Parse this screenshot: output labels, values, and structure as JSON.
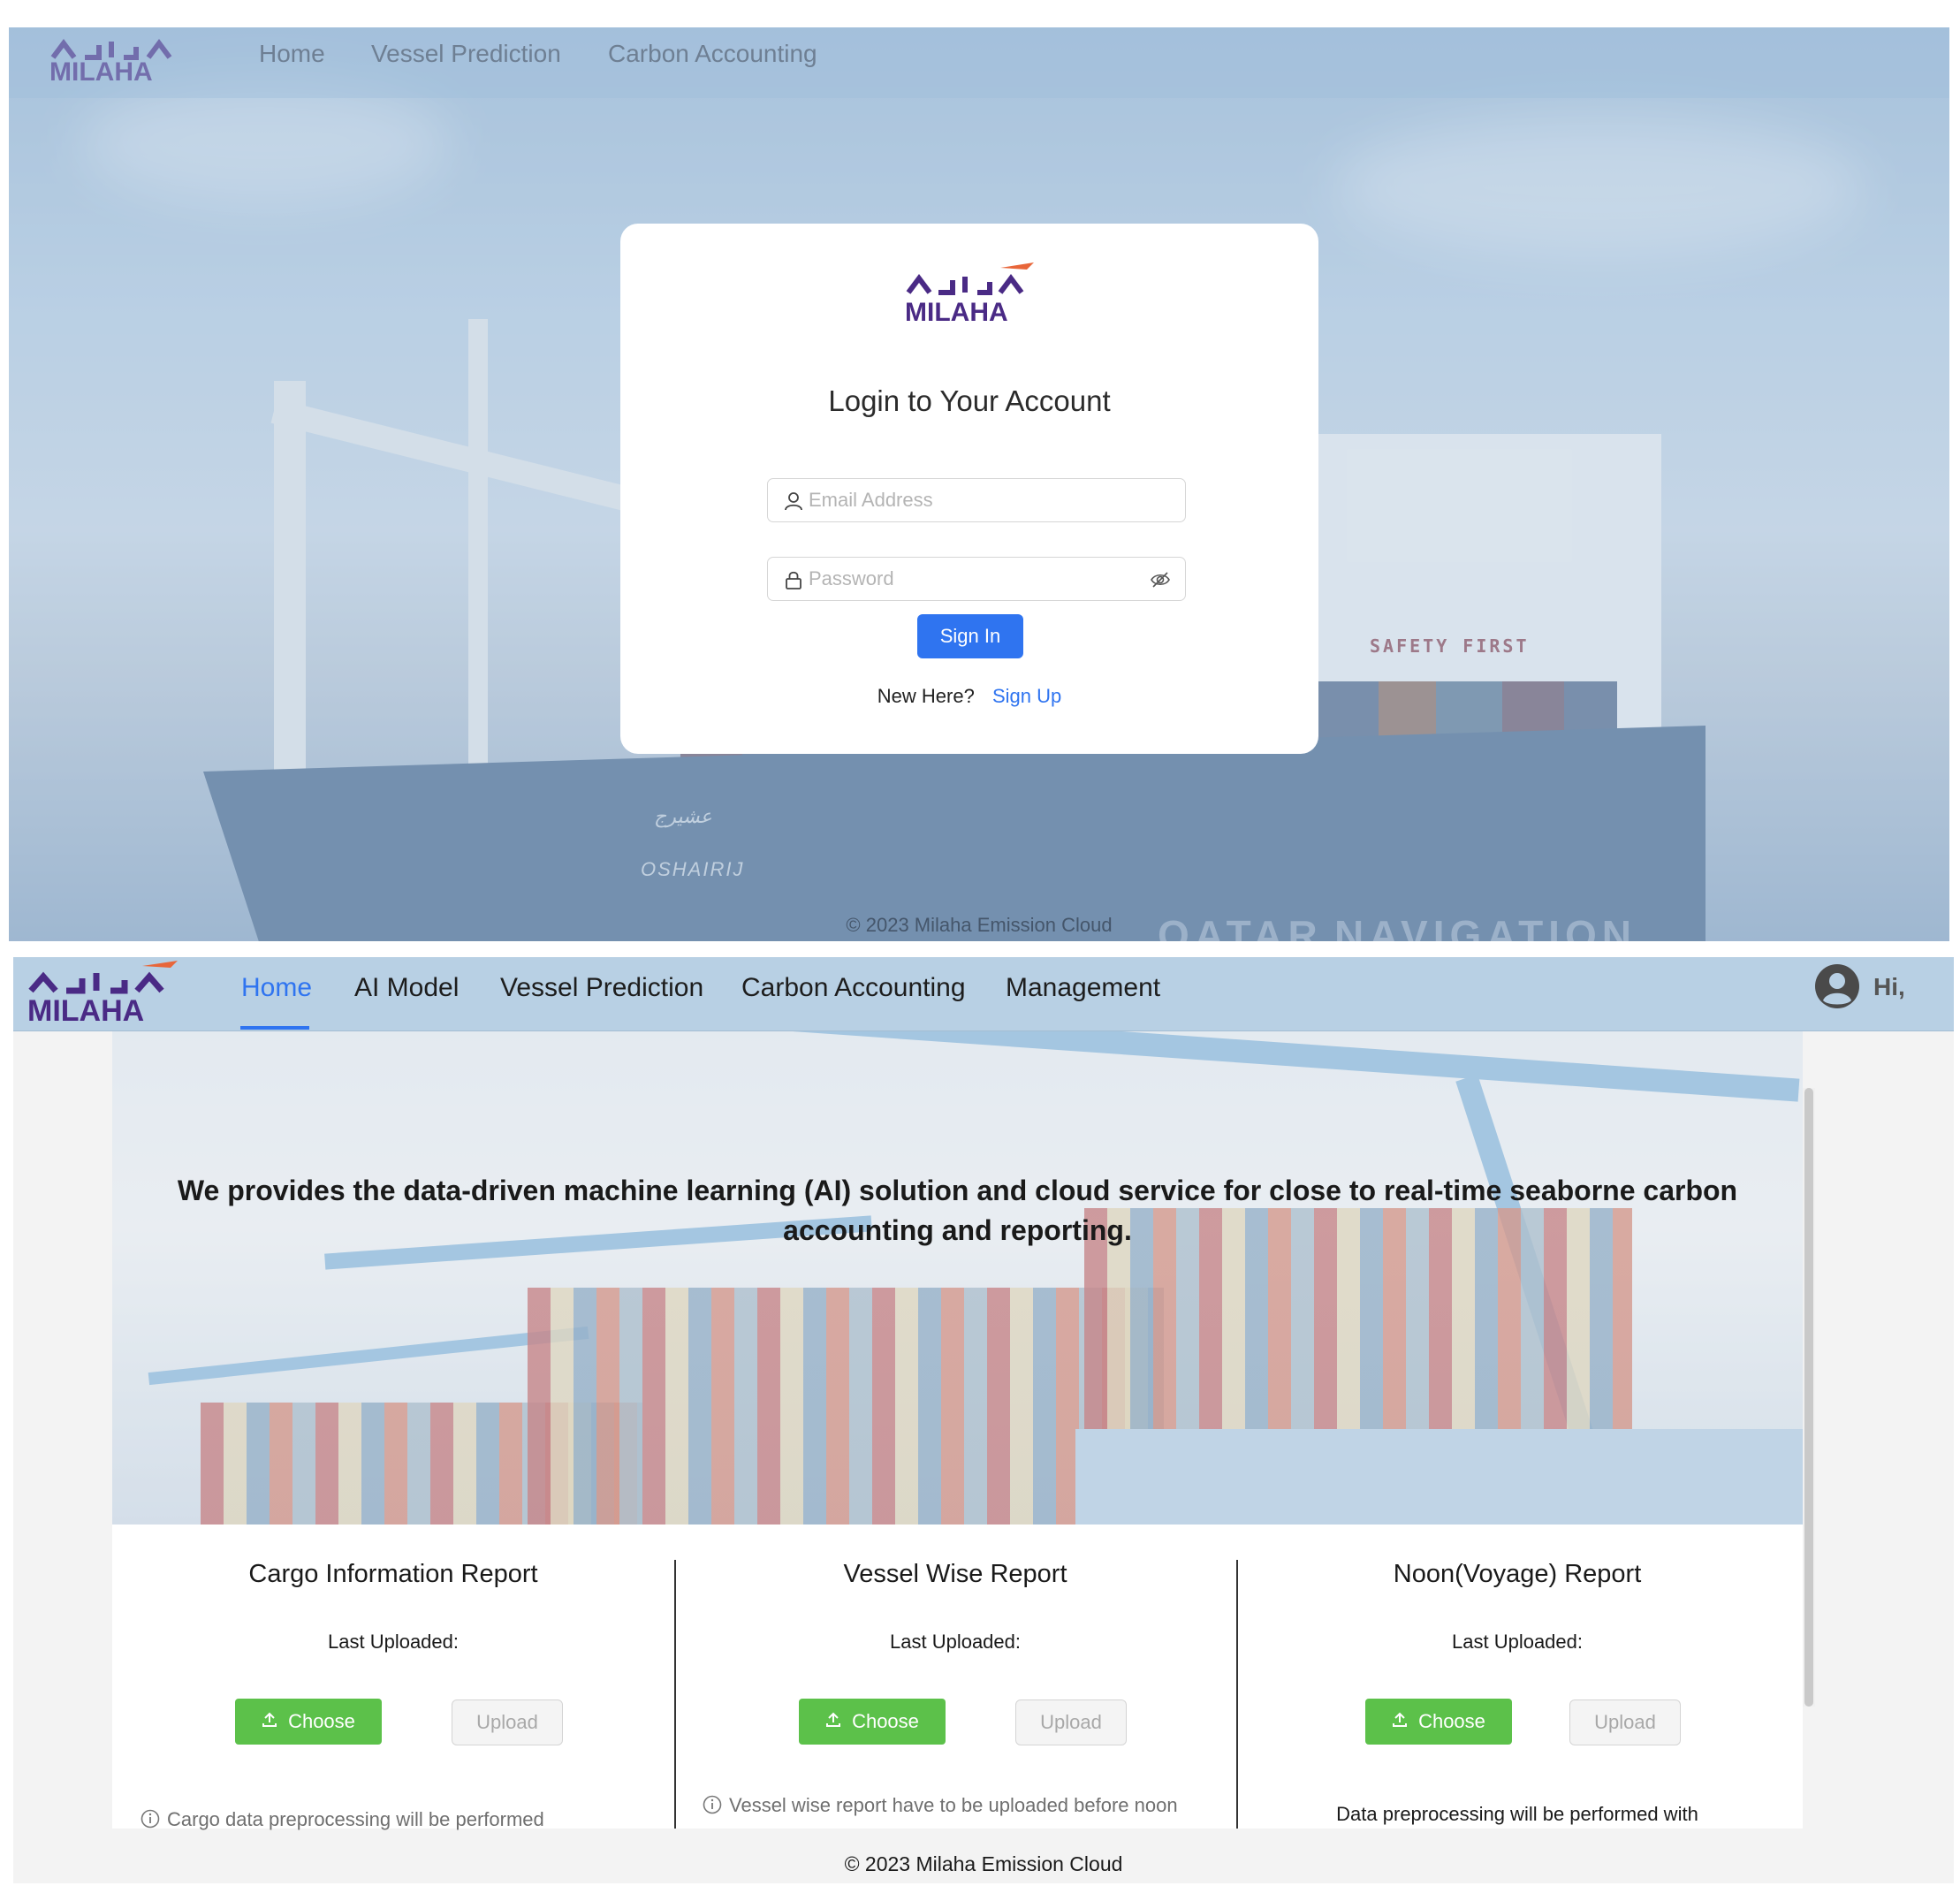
{
  "brand": {
    "logo_text": "MILAHA",
    "logo_color": "#4a2a85",
    "accent_color": "#e8663a"
  },
  "login": {
    "nav": {
      "items": [
        "Home",
        "Vessel Prediction",
        "Carbon Accounting"
      ]
    },
    "background_text": {
      "ship_name_arabic": "عشيرج",
      "ship_name": "OSHAIRIJ",
      "bridge_sign": "SAFETY FIRST",
      "hull_left": "QATAR",
      "hull_right": "NAVIGATION"
    },
    "card": {
      "title": "Login to Your Account",
      "email_placeholder": "Email Address",
      "password_placeholder": "Password",
      "signin_label": "Sign In",
      "new_here": "New Here?",
      "signup_label": "Sign Up"
    },
    "footer": "© 2023 Milaha Emission Cloud"
  },
  "home": {
    "nav": {
      "items": [
        "Home",
        "AI Model",
        "Vessel Prediction",
        "Carbon Accounting",
        "Management"
      ],
      "active": "Home",
      "greeting": "Hi,"
    },
    "hero_text": "We provides the data-driven machine learning (AI) solution and cloud service for close to real-time seaborne carbon accounting and reporting.",
    "reports": [
      {
        "title": "Cargo Information Report",
        "last_uploaded": "Last Uploaded:",
        "choose_label": "Choose",
        "upload_label": "Upload",
        "note": "Cargo data preprocessing will be performed",
        "note_icon": "info-icon"
      },
      {
        "title": "Vessel Wise Report",
        "last_uploaded": "Last Uploaded:",
        "choose_label": "Choose",
        "upload_label": "Upload",
        "note": "Vessel wise report have to be uploaded before noon",
        "note_icon": "info-icon"
      },
      {
        "title": "Noon(Voyage) Report",
        "last_uploaded": "Last Uploaded:",
        "choose_label": "Choose",
        "upload_label": "Upload",
        "note": "Data preprocessing will be performed with",
        "note_icon": ""
      }
    ],
    "footer": "© 2023 Milaha Emission Cloud"
  },
  "colors": {
    "primary": "#2f74f0",
    "success": "#5cc14a",
    "nav_bg": "#b8d0e4"
  }
}
